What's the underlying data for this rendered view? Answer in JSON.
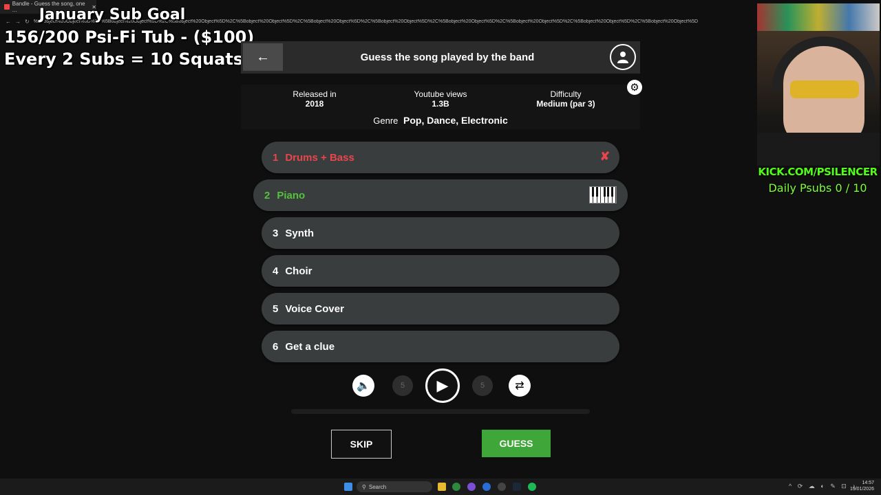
{
  "browser": {
    "tab_title": "Bandle - Guess the song, one ...",
    "url": "%5Bobject%20Object%5D%2C%5Bobject%20Object%5D%2C%5Bobject%20Object%5D%2C%5Bobject%20Object%5D%2C%5Bobject%20Object%5D%2C%5Bobject%20Object%5D%2C%5Bobject%20Object%5D%2C%5Bobject%20Object%5D%2C%5Bobject%20Object%5D%2C%5Bobject%20Object%5D"
  },
  "stream_overlay": {
    "goal_title": "January Sub Goal",
    "goal_progress": "156/200 Psi-Fi Tub - ($100)",
    "goal_rule": "Every 2 Subs = 10 Squats",
    "kick_url": "KICK.COM/PSILENCER",
    "daily_psubs": "Daily Psubs 0 / 10"
  },
  "header": {
    "back_icon": "arrow-left-icon",
    "title": "Guess the song played by the band",
    "profile_icon": "user-icon"
  },
  "info": {
    "released_label": "Released in",
    "released_value": "2018",
    "views_label": "Youtube views",
    "views_value": "1.3B",
    "difficulty_label": "Difficulty",
    "difficulty_value": "Medium (par 3)",
    "genre_label": "Genre",
    "genre_value": "Pop, Dance, Electronic"
  },
  "tracks": [
    {
      "num": "1",
      "label": "Drums + Bass",
      "state": "wrong"
    },
    {
      "num": "2",
      "label": "Piano",
      "state": "active"
    },
    {
      "num": "3",
      "label": "Synth",
      "state": "locked"
    },
    {
      "num": "4",
      "label": "Choir",
      "state": "locked"
    },
    {
      "num": "5",
      "label": "Voice Cover",
      "state": "locked"
    },
    {
      "num": "6",
      "label": "Get a clue",
      "state": "locked"
    }
  ],
  "controls": {
    "rewind_seconds": "5",
    "forward_seconds": "5",
    "playback_progress": 0
  },
  "actions": {
    "skip_label": "SKIP",
    "guess_label": "GUESS"
  },
  "taskbar": {
    "search_placeholder": "Search",
    "time": "14:57",
    "date": "19/01/2026"
  },
  "colors": {
    "wrong": "#e8464c",
    "active": "#53c33b",
    "guess_button": "#3fa639"
  }
}
